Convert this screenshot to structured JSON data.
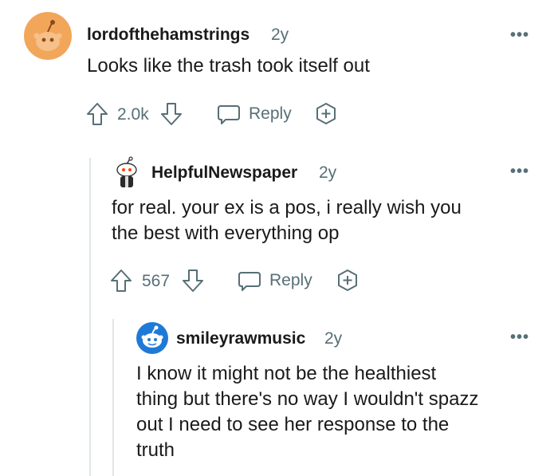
{
  "comments": [
    {
      "username": "lordofthehamstrings",
      "age": "2y",
      "text": "Looks like the trash took itself out",
      "votes": "2.0k",
      "reply_label": "Reply",
      "avatar_color": "#f2a65a"
    },
    {
      "username": "HelpfulNewspaper",
      "age": "2y",
      "text_lines": [
        "for real. your ex is a pos, i really wish you",
        "the best with everything op"
      ],
      "votes": "567",
      "reply_label": "Reply"
    },
    {
      "username": "smileyrawmusic",
      "age": "2y",
      "text_lines": [
        "I know it might not be the healthiest",
        "thing but there's no way I wouldn't spazz",
        "out I need to see her response to the",
        "truth"
      ],
      "avatar_color": "#1e7ad6"
    }
  ],
  "icons": {
    "upvote": "arrow-up-icon",
    "downvote": "arrow-down-icon",
    "reply": "speech-bubble-icon",
    "award": "plus-award-icon",
    "more": "more-options-icon"
  },
  "colors": {
    "meta_text": "#576f76",
    "thread_line": "#e0e6e8"
  }
}
